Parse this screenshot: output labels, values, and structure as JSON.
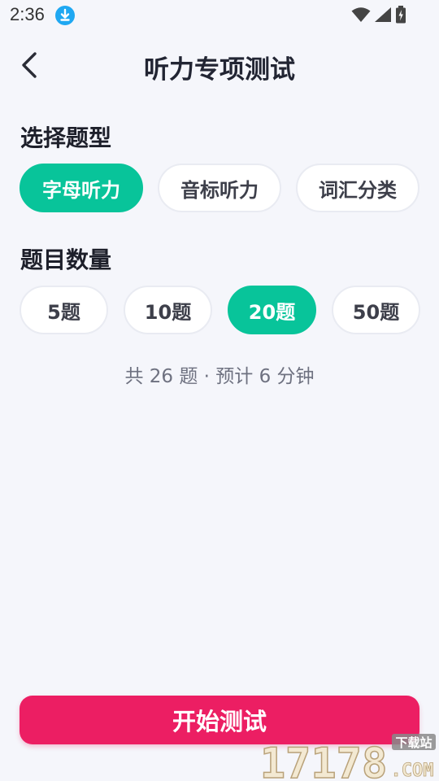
{
  "status_bar": {
    "time": "2:36",
    "icons": [
      "download-icon",
      "wifi-icon",
      "cellular-signal-icon",
      "battery-charging-icon"
    ]
  },
  "header": {
    "title": "听力专项测试",
    "back_icon": "chevron-left-icon"
  },
  "question_type": {
    "title": "选择题型",
    "options": [
      "字母听力",
      "音标听力",
      "词汇分类"
    ],
    "selected": "字母听力"
  },
  "question_count": {
    "title": "题目数量",
    "options": [
      "5题",
      "10题",
      "20题",
      "50题"
    ],
    "selected": "20题"
  },
  "summary_text": "共 26 题 · 预计 6 分钟",
  "start_button": {
    "label": "开始测试"
  },
  "watermark": {
    "text_main": "17178",
    "text_suffix": ".COM",
    "text_tag": "下载站"
  },
  "colors": {
    "accent_green": "#08c49a",
    "accent_pink": "#ec1e63",
    "background": "#f5f6fb",
    "download_badge": "#1fa8f2"
  }
}
